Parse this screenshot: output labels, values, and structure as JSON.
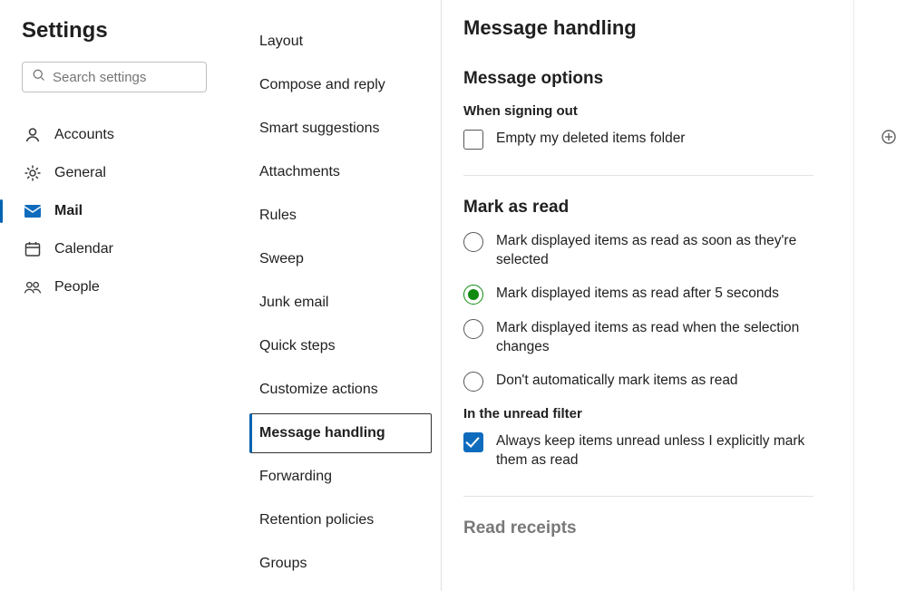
{
  "sidebar": {
    "title": "Settings",
    "search_placeholder": "Search settings",
    "items": [
      {
        "id": "accounts",
        "label": "Accounts"
      },
      {
        "id": "general",
        "label": "General"
      },
      {
        "id": "mail",
        "label": "Mail",
        "selected": true
      },
      {
        "id": "calendar",
        "label": "Calendar"
      },
      {
        "id": "people",
        "label": "People"
      }
    ]
  },
  "midnav": {
    "items": [
      "Layout",
      "Compose and reply",
      "Smart suggestions",
      "Attachments",
      "Rules",
      "Sweep",
      "Junk email",
      "Quick steps",
      "Customize actions",
      "Message handling",
      "Forwarding",
      "Retention policies",
      "Groups"
    ],
    "selected_index": 9
  },
  "page": {
    "title": "Message handling",
    "message_options": {
      "heading": "Message options",
      "signout_label": "When signing out",
      "empty_deleted": {
        "label": "Empty my deleted items folder",
        "checked": false
      }
    },
    "mark_as_read": {
      "heading": "Mark as read",
      "options": [
        "Mark displayed items as read as soon as they're selected",
        "Mark displayed items as read after 5 seconds",
        "Mark displayed items as read when the selection changes",
        "Don't automatically mark items as read"
      ],
      "selected_index": 1,
      "unread_filter": {
        "heading": "In the unread filter",
        "label": "Always keep items unread unless I explicitly mark them as read",
        "checked": true
      }
    },
    "read_receipts": {
      "heading": "Read receipts"
    }
  }
}
